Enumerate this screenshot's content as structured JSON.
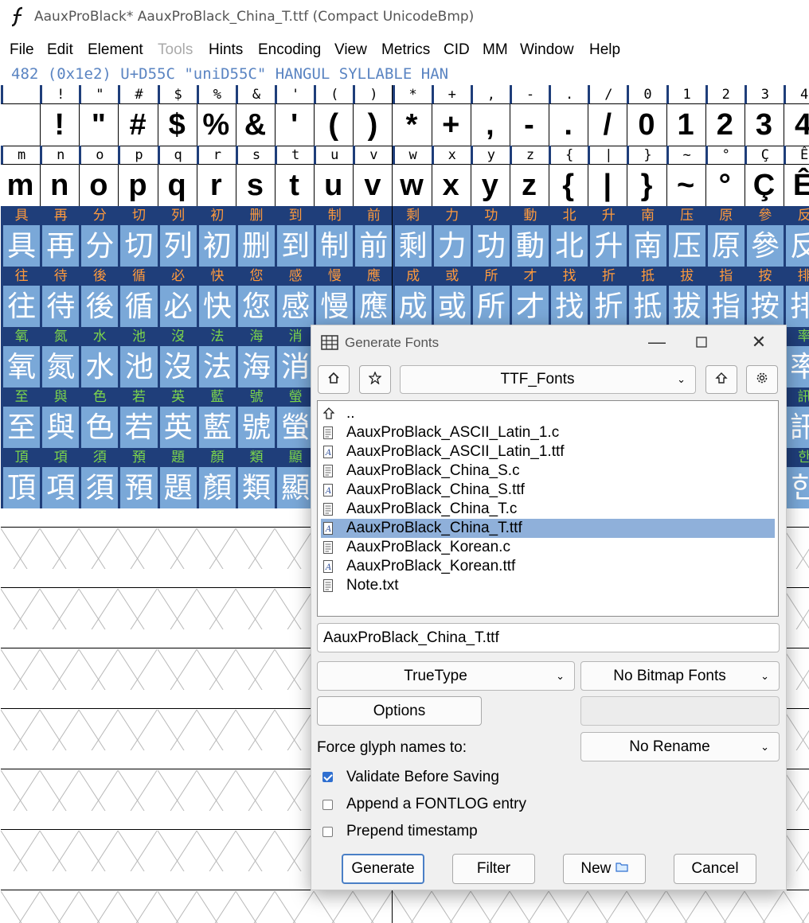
{
  "window": {
    "title": "AauxProBlack*  AauxProBlack_China_T.ttf (Compact UnicodeBmp)"
  },
  "menu": [
    "File",
    "Edit",
    "Element",
    "Tools",
    "Hints",
    "Encoding",
    "View",
    "Metrics",
    "CID",
    "MM",
    "Window",
    "Help"
  ],
  "info_line": "482 (0x1e2) U+D55C \"uniD55C\" HANGUL SYLLABLE HAN",
  "grid": {
    "row1": [
      "",
      "!",
      "\"",
      "#",
      "$",
      "%",
      "&",
      "'",
      "(",
      ")",
      "*",
      "+",
      ",",
      "-",
      ".",
      "/",
      "0",
      "1",
      "2",
      "3",
      "4"
    ],
    "row2": [
      "m",
      "n",
      "o",
      "p",
      "q",
      "r",
      "s",
      "t",
      "u",
      "v",
      "w",
      "x",
      "y",
      "z",
      "{",
      "|",
      "}",
      "~",
      "°",
      "Ç",
      "Ê"
    ],
    "row3": [
      "具",
      "再",
      "分",
      "切",
      "列",
      "初",
      "删",
      "到",
      "制",
      "前",
      "剩",
      "力",
      "功",
      "動",
      "北",
      "升",
      "南",
      "压",
      "原",
      "參",
      "反"
    ],
    "row4": [
      "往",
      "待",
      "後",
      "循",
      "必",
      "快",
      "您",
      "感",
      "慢",
      "應",
      "成",
      "或",
      "所",
      "才",
      "找",
      "折",
      "抵",
      "拔",
      "指",
      "按",
      "排"
    ],
    "row5": [
      "氧",
      "氮",
      "水",
      "池",
      "沒",
      "法",
      "海",
      "消",
      "",
      "",
      "",
      "",
      "",
      "",
      "",
      "",
      "",
      "",
      "",
      "",
      "率"
    ],
    "row6": [
      "至",
      "與",
      "色",
      "若",
      "英",
      "藍",
      "號",
      "螢",
      "",
      "",
      "",
      "",
      "",
      "",
      "",
      "",
      "",
      "",
      "",
      "",
      "訊"
    ],
    "row7": [
      "頂",
      "項",
      "須",
      "預",
      "題",
      "顏",
      "類",
      "顯",
      "",
      "",
      "",
      "",
      "",
      "",
      "",
      "",
      "",
      "",
      "",
      "",
      "한"
    ],
    "row5_label_color": "#7cd64b",
    "row6_label_color": "#7cd64b",
    "row7_label_color": "#7cd64b"
  },
  "dialog": {
    "title": "Generate Fonts",
    "directory": "TTF_Fonts",
    "files": [
      {
        "name": "..",
        "kind": "up"
      },
      {
        "name": "AauxProBlack_ASCII_Latin_1.c",
        "kind": "doc"
      },
      {
        "name": "AauxProBlack_ASCII_Latin_1.ttf",
        "kind": "font"
      },
      {
        "name": "AauxProBlack_China_S.c",
        "kind": "doc"
      },
      {
        "name": "AauxProBlack_China_S.ttf",
        "kind": "font"
      },
      {
        "name": "AauxProBlack_China_T.c",
        "kind": "doc"
      },
      {
        "name": "AauxProBlack_China_T.ttf",
        "kind": "font",
        "selected": true
      },
      {
        "name": "AauxProBlack_Korean.c",
        "kind": "doc"
      },
      {
        "name": "AauxProBlack_Korean.ttf",
        "kind": "font"
      },
      {
        "name": "Note.txt",
        "kind": "doc"
      }
    ],
    "filename": "AauxProBlack_China_T.ttf",
    "format": "TrueType",
    "bitmap": "No Bitmap Fonts",
    "options_label": "Options",
    "force_glyph_label": "Force glyph names to:",
    "rename": "No Rename",
    "checks": [
      {
        "label": "Validate Before Saving",
        "checked": true
      },
      {
        "label": "Append a FONTLOG entry",
        "checked": false
      },
      {
        "label": "Prepend timestamp",
        "checked": false
      }
    ],
    "buttons": {
      "generate": "Generate",
      "filter": "Filter",
      "new": "New",
      "cancel": "Cancel"
    }
  },
  "colors": {
    "accent": "#4a7fc6",
    "cjk_cell": "#7aa8d8",
    "cjk_label": "#1f3e7a",
    "selection": "#8fb0da",
    "info": "#5a84c2"
  }
}
